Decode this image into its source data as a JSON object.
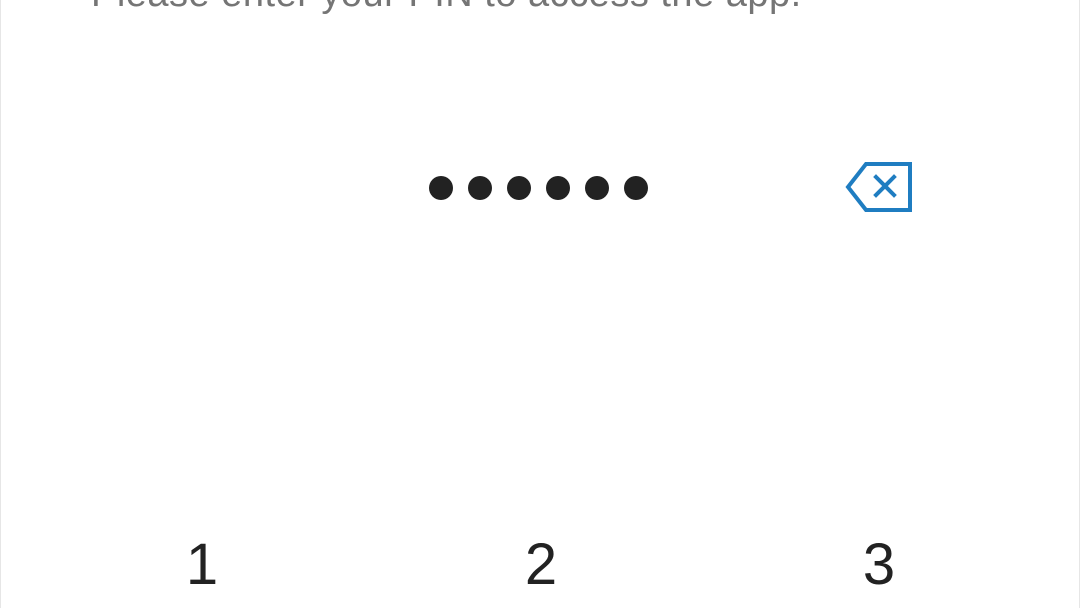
{
  "pin_screen": {
    "prompt_text": "Please enter your PIN to access the app.",
    "pin_length": 6,
    "backspace_icon": "backspace-icon",
    "accent_color": "#1f7dc1"
  },
  "keypad": {
    "keys": [
      "1",
      "2",
      "3"
    ]
  }
}
